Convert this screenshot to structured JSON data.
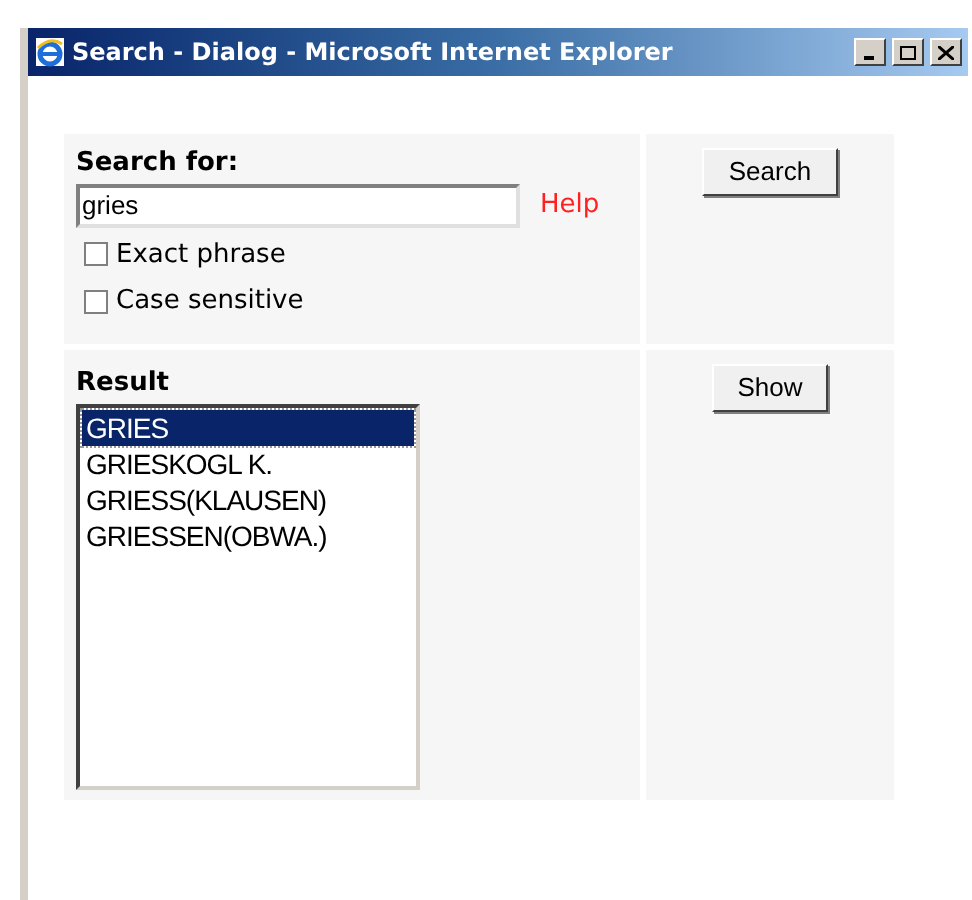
{
  "window": {
    "title": "Search - Dialog - Microsoft Internet Explorer"
  },
  "search": {
    "label": "Search for:",
    "value": "gries",
    "help": "Help",
    "button": "Search",
    "options": [
      {
        "label": "Exact phrase",
        "checked": false
      },
      {
        "label": "Case sensitive",
        "checked": false
      }
    ]
  },
  "result": {
    "label": "Result",
    "button": "Show",
    "items": [
      {
        "label": "GRIES",
        "selected": true
      },
      {
        "label": "GRIESKOGL K.",
        "selected": false
      },
      {
        "label": "GRIESS(KLAUSEN)",
        "selected": false
      },
      {
        "label": "GRIESSEN(OBWA.)",
        "selected": false
      }
    ]
  }
}
